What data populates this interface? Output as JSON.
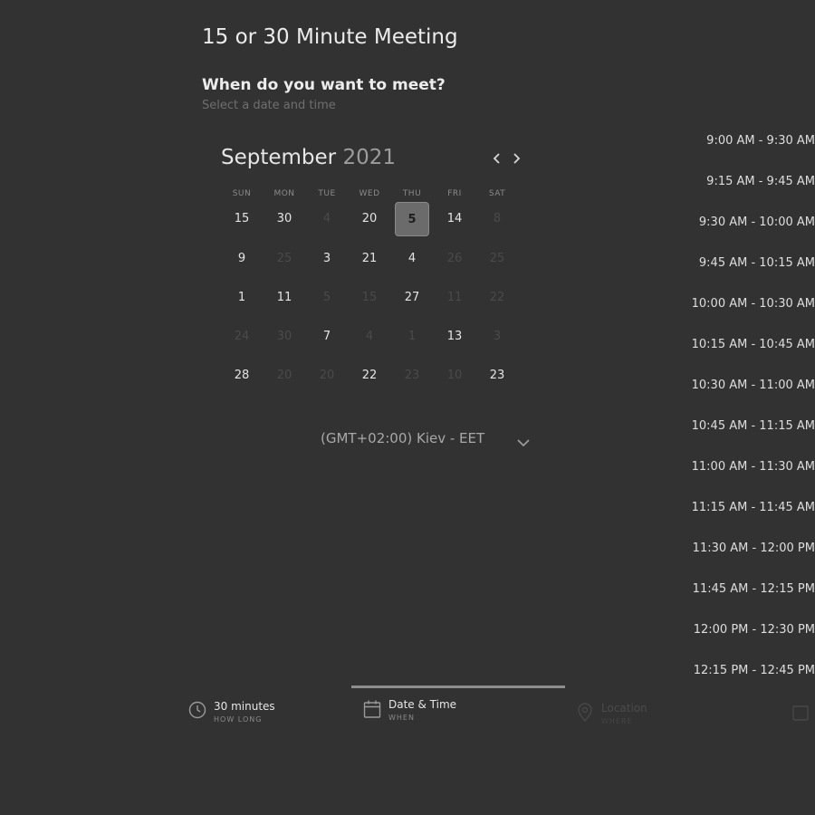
{
  "meeting": {
    "title": "15 or 30 Minute Meeting",
    "question": "When do you want to meet?",
    "subtitle": "Select a date and time"
  },
  "calendar": {
    "month": "September",
    "year": "2021",
    "weekdays": [
      "SUN",
      "MON",
      "TUE",
      "WED",
      "THU",
      "FRI",
      "SAT"
    ],
    "selected_day": "5",
    "rows": [
      [
        {
          "d": "15",
          "on": true
        },
        {
          "d": "30",
          "on": true
        },
        {
          "d": "4",
          "on": false
        },
        {
          "d": "20",
          "on": true
        },
        {
          "d": "5",
          "on": true,
          "sel": true
        },
        {
          "d": "14",
          "on": true
        },
        {
          "d": "8",
          "on": false
        }
      ],
      [
        {
          "d": "9",
          "on": true
        },
        {
          "d": "25",
          "on": false
        },
        {
          "d": "3",
          "on": true
        },
        {
          "d": "21",
          "on": true
        },
        {
          "d": "4",
          "on": true
        },
        {
          "d": "26",
          "on": false
        },
        {
          "d": "25",
          "on": false
        }
      ],
      [
        {
          "d": "1",
          "on": true
        },
        {
          "d": "11",
          "on": true
        },
        {
          "d": "5",
          "on": false
        },
        {
          "d": "15",
          "on": false
        },
        {
          "d": "27",
          "on": true
        },
        {
          "d": "11",
          "on": false
        },
        {
          "d": "22",
          "on": false
        }
      ],
      [
        {
          "d": "24",
          "on": false
        },
        {
          "d": "30",
          "on": false
        },
        {
          "d": "7",
          "on": true
        },
        {
          "d": "4",
          "on": false
        },
        {
          "d": "1",
          "on": false
        },
        {
          "d": "13",
          "on": true
        },
        {
          "d": "3",
          "on": false
        }
      ],
      [
        {
          "d": "28",
          "on": true
        },
        {
          "d": "20",
          "on": false
        },
        {
          "d": "20",
          "on": false
        },
        {
          "d": "22",
          "on": true
        },
        {
          "d": "23",
          "on": false
        },
        {
          "d": "10",
          "on": false
        },
        {
          "d": "23",
          "on": true
        }
      ]
    ]
  },
  "timezone": {
    "label": "(GMT+02:00) Kiev - EET"
  },
  "time_slots": [
    "9:00 AM - 9:30 AM",
    "9:15 AM - 9:45 AM",
    "9:30 AM - 10:00 AM",
    "9:45 AM - 10:15 AM",
    "10:00 AM - 10:30 AM",
    "10:15 AM - 10:45 AM",
    "10:30 AM - 11:00 AM",
    "10:45 AM - 11:15 AM",
    "11:00 AM - 11:30 AM",
    "11:15 AM - 11:45 AM",
    "11:30 AM - 12:00 PM",
    "11:45 AM - 12:15 PM",
    "12:00 PM - 12:30 PM",
    "12:15 PM - 12:45 PM"
  ],
  "steps": {
    "duration": {
      "label": "30 minutes",
      "sub": "HOW LONG",
      "icon": "clock-icon"
    },
    "datetime": {
      "label": "Date & Time",
      "sub": "WHEN",
      "icon": "calendar-icon"
    },
    "location": {
      "label": "Location",
      "sub": "WHERE",
      "icon": "location-pin-icon"
    },
    "details": {
      "icon": "document-icon"
    }
  },
  "colors": {
    "background": "#323232",
    "text": "#e8e8e8",
    "muted": "#6f6f6f",
    "disabled": "#4a4a4a",
    "selected_bg": "#6b6b6b",
    "active_bar": "#8d8d8d"
  }
}
